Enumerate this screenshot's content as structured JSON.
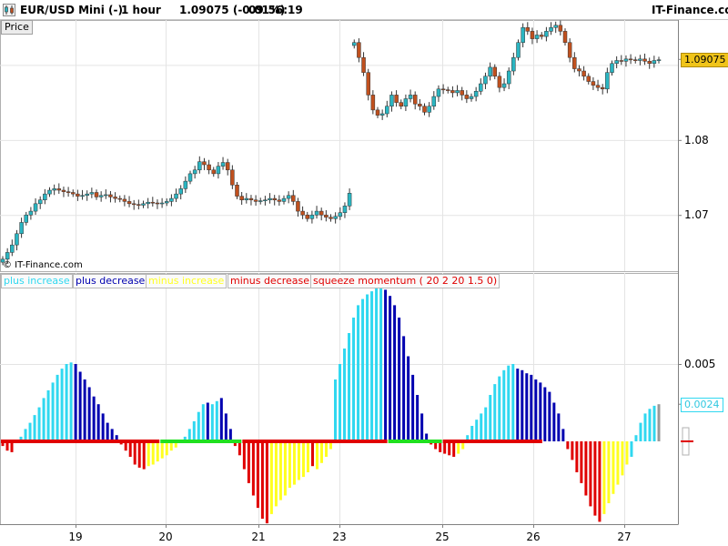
{
  "header": {
    "instrument": "EUR/USD Mini (-)",
    "timeframe": "1 hour",
    "last_price": "1.09075 (-0.01%)",
    "time": "09:56:19",
    "brand": "IT-Finance.com"
  },
  "price_panel": {
    "tab_label": "Price",
    "copyright": "© IT-Finance.com",
    "y_ticks": [
      {
        "label": "1.07",
        "value": 1.07
      },
      {
        "label": "1.08",
        "value": 1.08
      }
    ],
    "current_price_label": "1.09075",
    "current_price_value": 1.09075,
    "colors": {
      "up": "#2ab5c1",
      "down": "#c0501e",
      "wick": "#333333",
      "price_tag": "#f0c419"
    }
  },
  "indicator_panel": {
    "legend": [
      {
        "label": "plus increase",
        "color": "#30d8f0"
      },
      {
        "label": "plus decrease",
        "color": "#0000b0"
      },
      {
        "label": "minus increase",
        "color": "#ffff20"
      },
      {
        "label": "minus decrease",
        "color": "#e00000"
      },
      {
        "label": "squeeze momentum ( 20 2 20 1.5 0)",
        "color": "#e00000"
      }
    ],
    "y_ticks": [
      {
        "label": "0.005",
        "value": 0.005
      }
    ],
    "current_value_label": "0.0024",
    "current_value": 0.0024
  },
  "x_axis": {
    "labels": [
      "19",
      "20",
      "21",
      "23",
      "25",
      "26",
      "27"
    ]
  },
  "chart_data": {
    "type": "candlestick",
    "title": "EUR/USD Mini (-) 1 hour",
    "xlabel": "",
    "ylabel": "",
    "price_ylim": [
      1.0625,
      1.096
    ],
    "price_series": [
      1.0641,
      1.065,
      1.066,
      1.0675,
      1.069,
      1.07,
      1.0705,
      1.0715,
      1.072,
      1.0728,
      1.0733,
      1.0735,
      1.0733,
      1.0731,
      1.073,
      1.0728,
      1.0725,
      1.0726,
      1.0728,
      1.073,
      1.0724,
      1.0726,
      1.0727,
      1.0724,
      1.0722,
      1.0721,
      1.0718,
      1.0715,
      1.0714,
      1.0713,
      1.0715,
      1.0717,
      1.0716,
      1.0715,
      1.0716,
      1.0718,
      1.0722,
      1.0728,
      1.0735,
      1.0745,
      1.0755,
      1.076,
      1.0771,
      1.0767,
      1.076,
      1.0755,
      1.0765,
      1.077,
      1.076,
      1.074,
      1.0725,
      1.072,
      1.0722,
      1.072,
      1.0718,
      1.0719,
      1.072,
      1.0722,
      1.072,
      1.0718,
      1.0722,
      1.0726,
      1.0718,
      1.0705,
      1.07,
      1.0695,
      1.07,
      1.0705,
      1.07,
      1.0697,
      1.0695,
      1.0698,
      1.0703,
      1.0712,
      1.0729,
      1.093,
      1.091,
      1.089,
      1.086,
      1.084,
      1.0833,
      1.0835,
      1.0845,
      1.086,
      1.085,
      1.0845,
      1.0855,
      1.086,
      1.0848,
      1.0845,
      1.0837,
      1.0845,
      1.0858,
      1.0868,
      1.0867,
      1.0866,
      1.0863,
      1.0866,
      1.086,
      1.0855,
      1.0858,
      1.0865,
      1.0875,
      1.0885,
      1.0897,
      1.0885,
      1.087,
      1.0875,
      1.0892,
      1.091,
      1.093,
      1.095,
      1.0945,
      1.0935,
      1.094,
      1.0938,
      1.0945,
      1.095,
      1.0953,
      1.0945,
      1.093,
      1.091,
      1.0895,
      1.0892,
      1.0885,
      1.0878,
      1.0873,
      1.087,
      1.0868,
      1.089,
      1.0902,
      1.0906,
      1.0905,
      1.0908,
      1.0907,
      1.0906,
      1.0908,
      1.0905,
      1.0902,
      1.0906,
      1.0907
    ],
    "price_gap_after_index": 74,
    "momentum_ylim": [
      -0.0088,
      0.0018
    ],
    "momentum_ylim_top": 0.0075,
    "momentum_values": [
      -0.0003,
      -0.0006,
      -0.0007,
      -0.0001,
      0.0003,
      0.0008,
      0.0012,
      0.0017,
      0.0022,
      0.0028,
      0.0033,
      0.0038,
      0.0043,
      0.0047,
      0.005,
      0.0051,
      0.005,
      0.0045,
      0.004,
      0.0035,
      0.0029,
      0.0024,
      0.0018,
      0.0012,
      0.0008,
      0.0004,
      -0.0002,
      -0.0006,
      -0.001,
      -0.0015,
      -0.0017,
      -0.0018,
      -0.0016,
      -0.0015,
      -0.0013,
      -0.0011,
      -0.0009,
      -0.0006,
      -0.0004,
      -0.0001,
      0.0003,
      0.0008,
      0.0013,
      0.0019,
      0.0024,
      0.0025,
      0.0024,
      0.0026,
      0.0028,
      0.0018,
      0.0008,
      -0.0003,
      -0.0009,
      -0.0018,
      -0.0027,
      -0.0035,
      -0.0043,
      -0.005,
      -0.0053,
      -0.0047,
      -0.0042,
      -0.0038,
      -0.0035,
      -0.003,
      -0.0028,
      -0.0025,
      -0.0023,
      -0.002,
      -0.0016,
      -0.0018,
      -0.0014,
      -0.001,
      -0.0005,
      0.004,
      0.005,
      0.006,
      0.007,
      0.008,
      0.0088,
      0.0092,
      0.0095,
      0.0097,
      0.0099,
      0.01,
      0.0098,
      0.0094,
      0.0088,
      0.008,
      0.0068,
      0.0055,
      0.0043,
      0.003,
      0.0018,
      0.0005,
      -0.0002,
      -0.0005,
      -0.0007,
      -0.0008,
      -0.0009,
      -0.001,
      -0.0008,
      -0.0005,
      0.0004,
      0.001,
      0.0014,
      0.0018,
      0.0022,
      0.003,
      0.0037,
      0.0042,
      0.0046,
      0.0049,
      0.005,
      0.0047,
      0.0046,
      0.0044,
      0.0043,
      0.004,
      0.0038,
      0.0035,
      0.0032,
      0.0025,
      0.0018,
      0.0008,
      -0.0005,
      -0.0012,
      -0.002,
      -0.0027,
      -0.0035,
      -0.0042,
      -0.0048,
      -0.0052,
      -0.0047,
      -0.004,
      -0.0034,
      -0.0028,
      -0.0022,
      -0.0015,
      -0.001,
      0.0004,
      0.0012,
      0.0018,
      0.0021,
      0.0023,
      0.0024
    ],
    "momentum_colors": [
      "R",
      "R",
      "R",
      "C",
      "C",
      "C",
      "C",
      "C",
      "C",
      "C",
      "C",
      "C",
      "C",
      "C",
      "C",
      "C",
      "B",
      "B",
      "B",
      "B",
      "B",
      "B",
      "B",
      "B",
      "B",
      "B",
      "R",
      "R",
      "R",
      "R",
      "R",
      "R",
      "Y",
      "Y",
      "Y",
      "Y",
      "Y",
      "Y",
      "Y",
      "Y",
      "C",
      "C",
      "C",
      "C",
      "C",
      "B",
      "C",
      "C",
      "B",
      "B",
      "B",
      "R",
      "R",
      "R",
      "R",
      "R",
      "R",
      "R",
      "R",
      "Y",
      "Y",
      "Y",
      "Y",
      "Y",
      "Y",
      "Y",
      "Y",
      "Y",
      "R",
      "Y",
      "Y",
      "Y",
      "Y",
      "C",
      "C",
      "C",
      "C",
      "C",
      "C",
      "C",
      "C",
      "C",
      "C",
      "C",
      "B",
      "B",
      "B",
      "B",
      "B",
      "B",
      "B",
      "B",
      "B",
      "B",
      "R",
      "R",
      "R",
      "R",
      "R",
      "R",
      "Y",
      "Y",
      "C",
      "C",
      "C",
      "C",
      "C",
      "C",
      "C",
      "C",
      "C",
      "C",
      "C",
      "B",
      "B",
      "B",
      "B",
      "B",
      "B",
      "B",
      "B",
      "B",
      "B",
      "B",
      "R",
      "R",
      "R",
      "R",
      "R",
      "R",
      "R",
      "R",
      "Y",
      "Y",
      "Y",
      "Y",
      "Y",
      "Y",
      "C",
      "C",
      "C",
      "C",
      "C",
      "C"
    ],
    "squeeze_segments": [
      {
        "from": 0,
        "to": 34,
        "state": "on"
      },
      {
        "from": 35,
        "to": 52,
        "state": "off"
      },
      {
        "from": 53,
        "to": 84,
        "state": "on"
      },
      {
        "from": 85,
        "to": 96,
        "state": "off"
      },
      {
        "from": 97,
        "to": 118,
        "state": "on"
      }
    ],
    "dot_colors": {
      "on": "#e00000",
      "off": "#20e020"
    }
  }
}
